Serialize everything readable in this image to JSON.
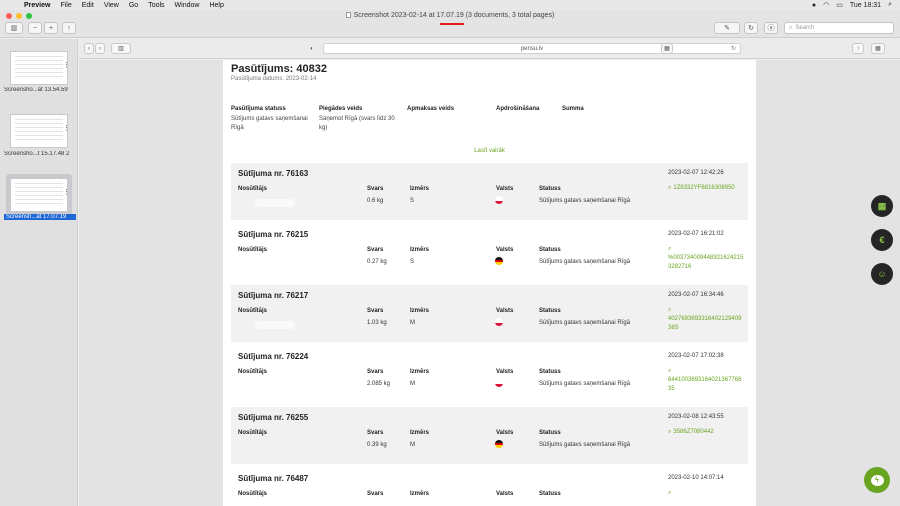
{
  "menubar": {
    "app": "Preview",
    "items": [
      "File",
      "Edit",
      "View",
      "Go",
      "Tools",
      "Window",
      "Help"
    ],
    "clock": "Tue 18:31"
  },
  "window": {
    "title": "Screenshot 2023-02-14 at 17.07.19 (3 documents, 3 total pages)",
    "search_placeholder": "Search"
  },
  "sidebar": {
    "thumbnails": [
      {
        "label": "Screensho...at 13.54.59",
        "selected": false
      },
      {
        "label": "Screensho...t 15.17.48 2",
        "selected": false
      },
      {
        "label": "Screensh...at 17.07.19",
        "selected": true
      }
    ]
  },
  "browser": {
    "url": "pensu.lv"
  },
  "order": {
    "title": "Pasūtījums: 40832",
    "date": "Pasūtījuma datums: 2023-02-14",
    "info_headers": [
      "Pasūtījuma statuss",
      "Piegādes veids",
      "Apmaksas veids",
      "Apdrošināšana",
      "Summa"
    ],
    "status": "Sūtījums gatavs saņemšanai Rīgā",
    "delivery": "Saņemot Rīgā (svars līdz 30 kg)",
    "read_more": "Lasīt vairāk"
  },
  "shipment_headers": {
    "sender": "Nosūtītājs",
    "weight": "Svars",
    "size": "Izmērs",
    "country": "Valsts",
    "status": "Statuss"
  },
  "shipments": [
    {
      "title": "Sūtījuma nr. 76163",
      "datetime": "2023-02-07 12:42:26",
      "weight": "0.6 kg",
      "size": "S",
      "status": "Sūtījums gatavs saņemšanai Rīgā",
      "tracking": "1Z8332YF6816308950",
      "flag": "pl"
    },
    {
      "title": "Sūtījuma nr. 76215",
      "datetime": "2023-02-07 16:21:02",
      "weight": "0.27 kg",
      "size": "S",
      "status": "Sūtījums gatavs saņemšanai Rīgā",
      "tracking": "%0037340094489216242153282716",
      "flag": "de"
    },
    {
      "title": "Sūtījuma nr. 76217",
      "datetime": "2023-02-07 16:34:46",
      "weight": "1.03 kg",
      "size": "M",
      "status": "Sūtījums gatavs saņemšanai Rīgā",
      "tracking": "402769369331640212940938S",
      "flag": "pl"
    },
    {
      "title": "Sūtījuma nr. 76224",
      "datetime": "2023-02-07 17:02:38",
      "weight": "2.085 kg",
      "size": "M",
      "status": "Sūtījums gatavs saņemšanai Rīgā",
      "tracking": "644100369316402136776835",
      "flag": "pl"
    },
    {
      "title": "Sūtījuma nr. 76255",
      "datetime": "2023-02-08 12:43:55",
      "weight": "0.39 kg",
      "size": "M",
      "status": "Sūtījums gatavs saņemšanai Rīgā",
      "tracking": "3586Z7080442",
      "flag": "de"
    },
    {
      "title": "Sūtījuma nr. 76487",
      "datetime": "2023-02-10 14:07:14",
      "weight": "",
      "size": "",
      "status": "",
      "tracking": "",
      "flag": ""
    }
  ],
  "icons": {
    "fab1": "grid-icon",
    "fab2": "euro-icon",
    "fab3": "user-icon",
    "chat": "messenger-icon"
  },
  "colors": {
    "accent": "#6aa521",
    "fab_bg": "#252525"
  }
}
